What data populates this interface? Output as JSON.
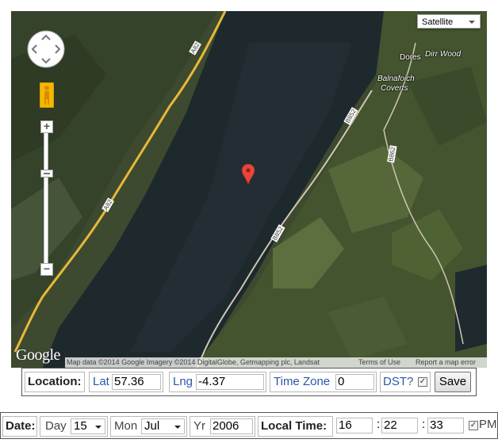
{
  "map": {
    "type_selector": "Satellite",
    "places": {
      "dores": "Dores",
      "dirr_wood": "Dirr Wood",
      "balnafoich_1": "Balnafoich",
      "balnafoich_2": "Coverts"
    },
    "roads": {
      "a82_top": "A82",
      "a82_bottom": "A82",
      "b852_top": "B852",
      "b852_bottom": "B852",
      "b862": "B862"
    },
    "logo": "Google",
    "attribution": {
      "data": "Map data ©2014 Google Imagery ©2014 DigitalGlobe, Getmapping plc, Landsat",
      "terms": "Terms of Use",
      "report": "Report a map error"
    }
  },
  "location": {
    "label": "Location:",
    "lat_label": "Lat",
    "lat_value": "57.36",
    "lng_label": "Lng",
    "lng_value": "-4.37",
    "tz_label": "Time Zone",
    "tz_value": "0",
    "dst_label": "DST?",
    "dst_checked": true,
    "save_label": "Save"
  },
  "datetime": {
    "date_label": "Date:",
    "day_label": "Day",
    "day_value": "15",
    "mon_label": "Mon",
    "mon_value": "Jul",
    "yr_label": "Yr",
    "yr_value": "2006",
    "local_time_label": "Local Time:",
    "hour": "16",
    "sep1": ":",
    "minute": "22",
    "sep2": ":",
    "second": "33",
    "pm_label": "PM",
    "pm_checked": true
  },
  "colors": {
    "water": "#1f2a2e",
    "land": "#3d4a2e",
    "road": "#e6b93a",
    "marker": "#e8453c",
    "link_blue": "#2a57a8"
  }
}
